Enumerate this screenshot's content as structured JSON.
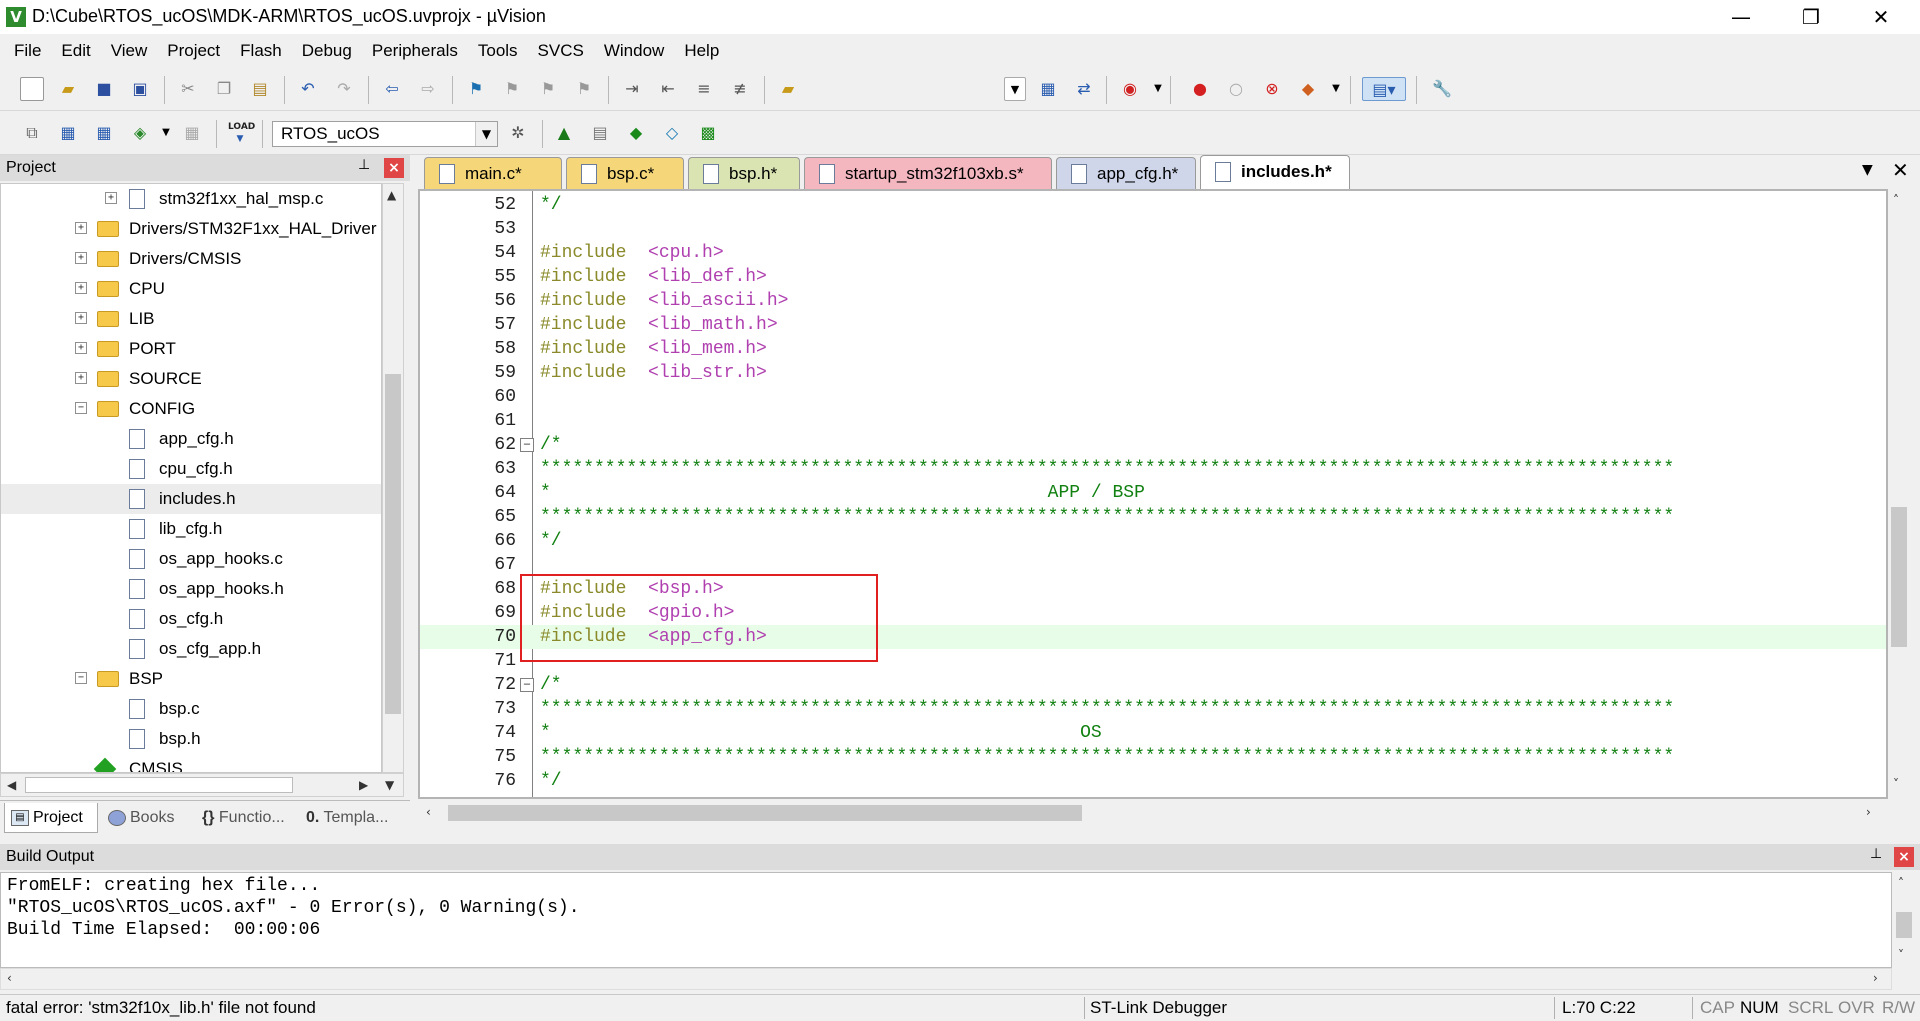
{
  "window": {
    "title": "D:\\Cube\\RTOS_ucOS\\MDK-ARM\\RTOS_ucOS.uvprojx - µVision",
    "logo_letter": "V",
    "minimize": "—",
    "restore": "❐",
    "close": "✕"
  },
  "menu": [
    "File",
    "Edit",
    "View",
    "Project",
    "Flash",
    "Debug",
    "Peripherals",
    "Tools",
    "SVCS",
    "Window",
    "Help"
  ],
  "toolbar": {
    "target": "RTOS_ucOS",
    "load_label": "LOAD"
  },
  "project_panel": {
    "title": "Project",
    "pin": "⊥",
    "close": "×",
    "tree": [
      {
        "label": "stm32f1xx_hal_msp.c",
        "type": "file",
        "indent": 2,
        "expander": "+"
      },
      {
        "label": "Drivers/STM32F1xx_HAL_Driver",
        "type": "folder",
        "indent": 1,
        "expander": "+"
      },
      {
        "label": "Drivers/CMSIS",
        "type": "folder",
        "indent": 1,
        "expander": "+"
      },
      {
        "label": "CPU",
        "type": "folder",
        "indent": 1,
        "expander": "+"
      },
      {
        "label": "LIB",
        "type": "folder",
        "indent": 1,
        "expander": "+"
      },
      {
        "label": "PORT",
        "type": "folder",
        "indent": 1,
        "expander": "+"
      },
      {
        "label": "SOURCE",
        "type": "folder",
        "indent": 1,
        "expander": "+"
      },
      {
        "label": "CONFIG",
        "type": "folder",
        "indent": 1,
        "expander": "−"
      },
      {
        "label": "app_cfg.h",
        "type": "file",
        "indent": 2,
        "expander": ""
      },
      {
        "label": "cpu_cfg.h",
        "type": "file",
        "indent": 2,
        "expander": ""
      },
      {
        "label": "includes.h",
        "type": "file",
        "indent": 2,
        "expander": "",
        "selected": true
      },
      {
        "label": "lib_cfg.h",
        "type": "file",
        "indent": 2,
        "expander": ""
      },
      {
        "label": "os_app_hooks.c",
        "type": "file",
        "indent": 2,
        "expander": ""
      },
      {
        "label": "os_app_hooks.h",
        "type": "file",
        "indent": 2,
        "expander": ""
      },
      {
        "label": "os_cfg.h",
        "type": "file",
        "indent": 2,
        "expander": ""
      },
      {
        "label": "os_cfg_app.h",
        "type": "file",
        "indent": 2,
        "expander": ""
      },
      {
        "label": "BSP",
        "type": "folder",
        "indent": 1,
        "expander": "−"
      },
      {
        "label": "bsp.c",
        "type": "file",
        "indent": 2,
        "expander": ""
      },
      {
        "label": "bsp.h",
        "type": "file",
        "indent": 2,
        "expander": ""
      },
      {
        "label": "CMSIS",
        "type": "cmsis",
        "indent": 1,
        "expander": ""
      }
    ],
    "bottom_tabs": [
      "Project",
      "Books",
      "Functio...",
      "Templa..."
    ]
  },
  "editor": {
    "tabs": [
      {
        "label": "main.c*",
        "color": "#f5d77a",
        "active": false
      },
      {
        "label": "bsp.c*",
        "color": "#f5d77a",
        "active": false
      },
      {
        "label": "bsp.h*",
        "color": "#d9e4b2",
        "active": false
      },
      {
        "label": "startup_stm32f103xb.s*",
        "color": "#f4b7c0",
        "active": false
      },
      {
        "label": "app_cfg.h*",
        "color": "#cfd6ea",
        "active": false
      },
      {
        "label": "includes.h*",
        "color": "#ffffff",
        "active": true
      }
    ],
    "lines": [
      {
        "n": "52",
        "code": "*/",
        "kind": "comment",
        "fold": ""
      },
      {
        "n": "53",
        "code": "",
        "kind": "plain",
        "fold": ""
      },
      {
        "n": "54",
        "kw": "#include",
        "hdr": "<cpu.h>",
        "kind": "include",
        "fold": ""
      },
      {
        "n": "55",
        "kw": "#include",
        "hdr": "<lib_def.h>",
        "kind": "include",
        "fold": ""
      },
      {
        "n": "56",
        "kw": "#include",
        "hdr": "<lib_ascii.h>",
        "kind": "include",
        "fold": ""
      },
      {
        "n": "57",
        "kw": "#include",
        "hdr": "<lib_math.h>",
        "kind": "include",
        "fold": ""
      },
      {
        "n": "58",
        "kw": "#include",
        "hdr": "<lib_mem.h>",
        "kind": "include",
        "fold": ""
      },
      {
        "n": "59",
        "kw": "#include",
        "hdr": "<lib_str.h>",
        "kind": "include",
        "fold": ""
      },
      {
        "n": "60",
        "code": "",
        "kind": "plain",
        "fold": ""
      },
      {
        "n": "61",
        "code": "",
        "kind": "plain",
        "fold": ""
      },
      {
        "n": "62",
        "code": "/*",
        "kind": "comment",
        "fold": "−"
      },
      {
        "n": "63",
        "code": "*********************************************************************************************************",
        "kind": "comment",
        "fold": ""
      },
      {
        "n": "64",
        "code": "*                                              APP / BSP",
        "kind": "comment",
        "fold": ""
      },
      {
        "n": "65",
        "code": "*********************************************************************************************************",
        "kind": "comment",
        "fold": ""
      },
      {
        "n": "66",
        "code": "*/",
        "kind": "comment",
        "fold": ""
      },
      {
        "n": "67",
        "code": "",
        "kind": "plain",
        "fold": ""
      },
      {
        "n": "68",
        "kw": "#include",
        "hdr": "<bsp.h>",
        "kind": "include",
        "fold": ""
      },
      {
        "n": "69",
        "kw": "#include",
        "hdr": "<gpio.h>",
        "kind": "include",
        "fold": ""
      },
      {
        "n": "70",
        "kw": "#include",
        "hdr": "<app_cfg.h>",
        "kind": "include",
        "fold": "",
        "highlight": true
      },
      {
        "n": "71",
        "code": "",
        "kind": "plain",
        "fold": ""
      },
      {
        "n": "72",
        "code": "/*",
        "kind": "comment",
        "fold": "−"
      },
      {
        "n": "73",
        "code": "*********************************************************************************************************",
        "kind": "comment",
        "fold": ""
      },
      {
        "n": "74",
        "code": "*                                                 OS",
        "kind": "comment",
        "fold": ""
      },
      {
        "n": "75",
        "code": "*********************************************************************************************************",
        "kind": "comment",
        "fold": ""
      },
      {
        "n": "76",
        "code": "*/",
        "kind": "comment",
        "fold": ""
      }
    ]
  },
  "build_output": {
    "title": "Build Output",
    "lines": [
      "FromELF: creating hex file...",
      "\"RTOS_ucOS\\RTOS_ucOS.axf\" - 0 Error(s), 0 Warning(s).",
      "Build Time Elapsed:  00:00:06"
    ]
  },
  "statusbar": {
    "message": "fatal error: 'stm32f10x_lib.h' file not found",
    "debugger": "ST-Link Debugger",
    "position": "L:70 C:22",
    "cap": "CAP",
    "num": "NUM",
    "scrl": "SCRL",
    "ovr": "OVR",
    "rw": "R/W"
  }
}
